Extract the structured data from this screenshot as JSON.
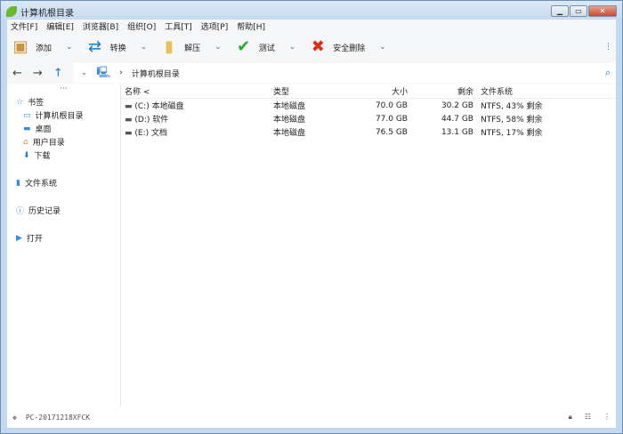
{
  "window": {
    "title": "计算机根目录"
  },
  "menu": [
    "文件[F]",
    "编辑[E]",
    "浏览器[B]",
    "组织[O]",
    "工具[T]",
    "选项[P]",
    "帮助[H]"
  ],
  "toolbar": [
    {
      "label": "添加",
      "icon": "📦",
      "color": "#c8943c"
    },
    {
      "label": "转换",
      "icon": "⇄",
      "color": "#1a78c8"
    },
    {
      "label": "解压",
      "icon": "▮",
      "color": "#e8c15a"
    },
    {
      "label": "测试",
      "icon": "✔",
      "color": "#2ea82e"
    },
    {
      "label": "安全删除",
      "icon": "✖",
      "color": "#d9301e"
    }
  ],
  "address": {
    "path": "计算机根目录"
  },
  "sidebar": {
    "bookmarks": "书签",
    "items": [
      "计算机根目录",
      "桌面",
      "用户目录",
      "下载"
    ],
    "filesystem": "文件系统",
    "history": "历史记录",
    "open": "打开"
  },
  "table": {
    "headers": [
      "名称 <",
      "类型",
      "大小",
      "剩余",
      "文件系统"
    ],
    "rows": [
      [
        "(C:) 本地磁盘",
        "本地磁盘",
        "70.0 GB",
        "30.2 GB",
        "NTFS, 43% 剩余"
      ],
      [
        "(D:) 软件",
        "本地磁盘",
        "77.0 GB",
        "44.7 GB",
        "NTFS, 58% 剩余"
      ],
      [
        "(E:) 文档",
        "本地磁盘",
        "76.5 GB",
        "13.1 GB",
        "NTFS, 17% 剩余"
      ]
    ]
  },
  "status": {
    "computer": "PC-20171218XFCK"
  }
}
